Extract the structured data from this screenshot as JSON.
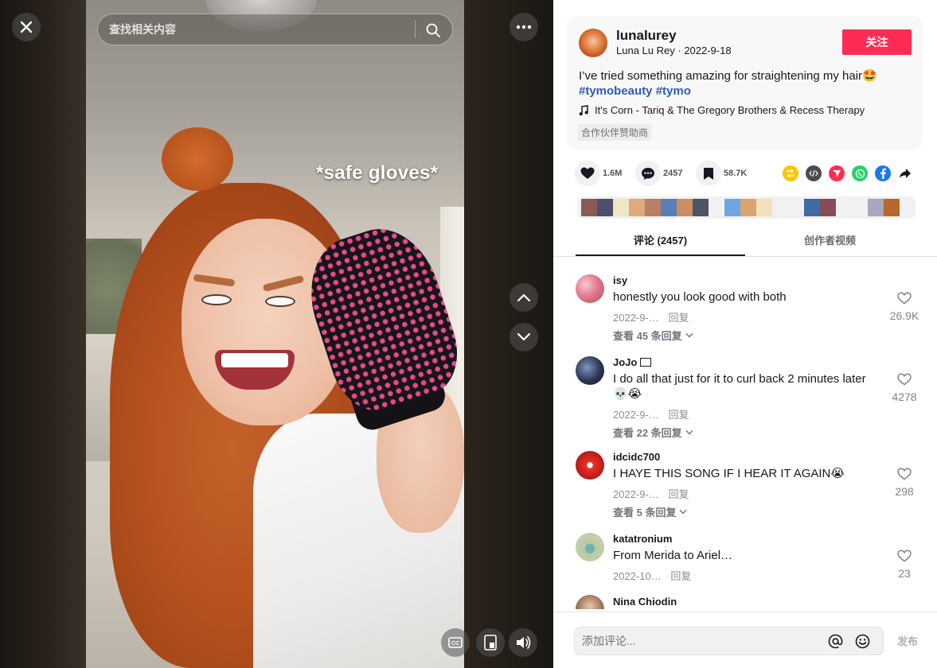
{
  "search": {
    "placeholder": "查找相关内容"
  },
  "video": {
    "overlay_text": "*safe gloves*"
  },
  "author": {
    "id": "lunalurey",
    "nickname": "Luna Lu Rey",
    "date": "2022-9-18",
    "follow_label": "关注"
  },
  "description": {
    "text": "I’ve tried something amazing for straightening my hair🤩",
    "hashtags": [
      "#tymobeauty",
      "#tymo"
    ]
  },
  "music": {
    "icon": "music-note-icon",
    "title": "It's Corn - Tariq & The Gregory Brothers & Recess Therapy"
  },
  "sponsor_label": "合作伙伴赞助商",
  "stats": {
    "likes": "1.6M",
    "comments": "2457",
    "saves": "58.7K"
  },
  "share_icons": [
    "repost-icon",
    "embed-icon",
    "send-icon",
    "whatsapp-icon",
    "facebook-icon",
    "share-arrow-icon"
  ],
  "tabs": {
    "comments_label": "评论 (2457)",
    "creator_videos_label": "创作者视频"
  },
  "comments": [
    {
      "user": "isy",
      "text": "honestly you look good with both",
      "date": "2022-9-…",
      "reply_label": "回复",
      "likes": "26.9K",
      "more_replies": "查看 45 条回复"
    },
    {
      "user": "JoJo",
      "text": "I do all that just for it to curl back 2 minutes later 💀😭",
      "date": "2022-9-…",
      "reply_label": "回复",
      "likes": "4278",
      "more_replies": "查看 22 条回复"
    },
    {
      "user": "idcidc700",
      "text": "I HAYE THIS SONG IF I HEAR IT AGAIN😭",
      "date": "2022-9-…",
      "reply_label": "回复",
      "likes": "298",
      "more_replies": "查看 5 条回复"
    },
    {
      "user": "katatronium",
      "text": "From Merida to Ariel…",
      "date": "2022-10…",
      "reply_label": "回复",
      "likes": "23"
    },
    {
      "user": "Nina Chiodin"
    }
  ],
  "comment_input": {
    "placeholder": "添加评论...",
    "post_label": "发布"
  },
  "colors": {
    "accent": "#fe2c55",
    "hashtag": "#2b5db9"
  }
}
